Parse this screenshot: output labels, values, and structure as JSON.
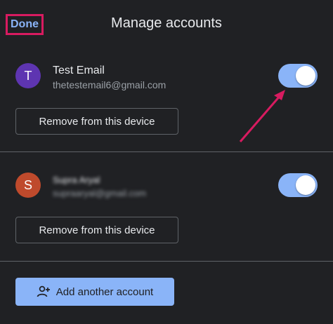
{
  "header": {
    "done_label": "Done",
    "title": "Manage accounts"
  },
  "accounts": [
    {
      "avatar_letter": "T",
      "avatar_color": "#5e35b1",
      "name": "Test Email",
      "email": "thetestemail6@gmail.com",
      "enabled": true,
      "remove_label": "Remove from this device"
    },
    {
      "avatar_letter": "S",
      "avatar_color": "#bf4a2c",
      "name": "Supra Aryal",
      "email": "supraaryal@gmail.com",
      "enabled": true,
      "remove_label": "Remove from this device"
    }
  ],
  "add_account": {
    "label": "Add another account",
    "icon": "add-person-icon"
  },
  "colors": {
    "background": "#202124",
    "accent": "#8ab4f8",
    "highlight": "#d81b60"
  }
}
